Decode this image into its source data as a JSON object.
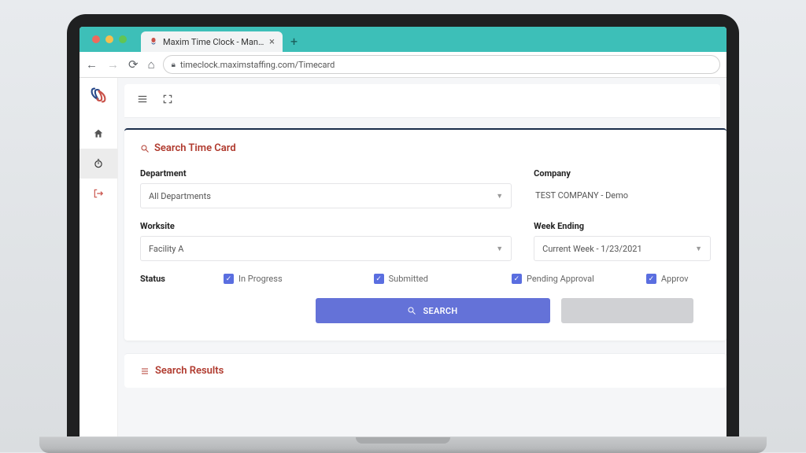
{
  "browser": {
    "tab_title": "Maxim Time Clock - Manage Ti",
    "url": "timeclock.maximstaffing.com/Timecard"
  },
  "panel": {
    "title": "Search Time Card"
  },
  "form": {
    "department": {
      "label": "Department",
      "value": "All Departments"
    },
    "company": {
      "label": "Company",
      "value": "TEST COMPANY - Demo"
    },
    "worksite": {
      "label": "Worksite",
      "value": "Facility A"
    },
    "week_ending": {
      "label": "Week Ending",
      "value": "Current Week - 1/23/2021"
    },
    "status": {
      "label": "Status",
      "options": [
        {
          "label": "In Progress",
          "checked": true
        },
        {
          "label": "Submitted",
          "checked": true
        },
        {
          "label": "Pending Approval",
          "checked": true
        },
        {
          "label": "Approv",
          "checked": true
        }
      ]
    }
  },
  "buttons": {
    "search": "SEARCH",
    "reset": ""
  },
  "results": {
    "title": "Search Results"
  }
}
